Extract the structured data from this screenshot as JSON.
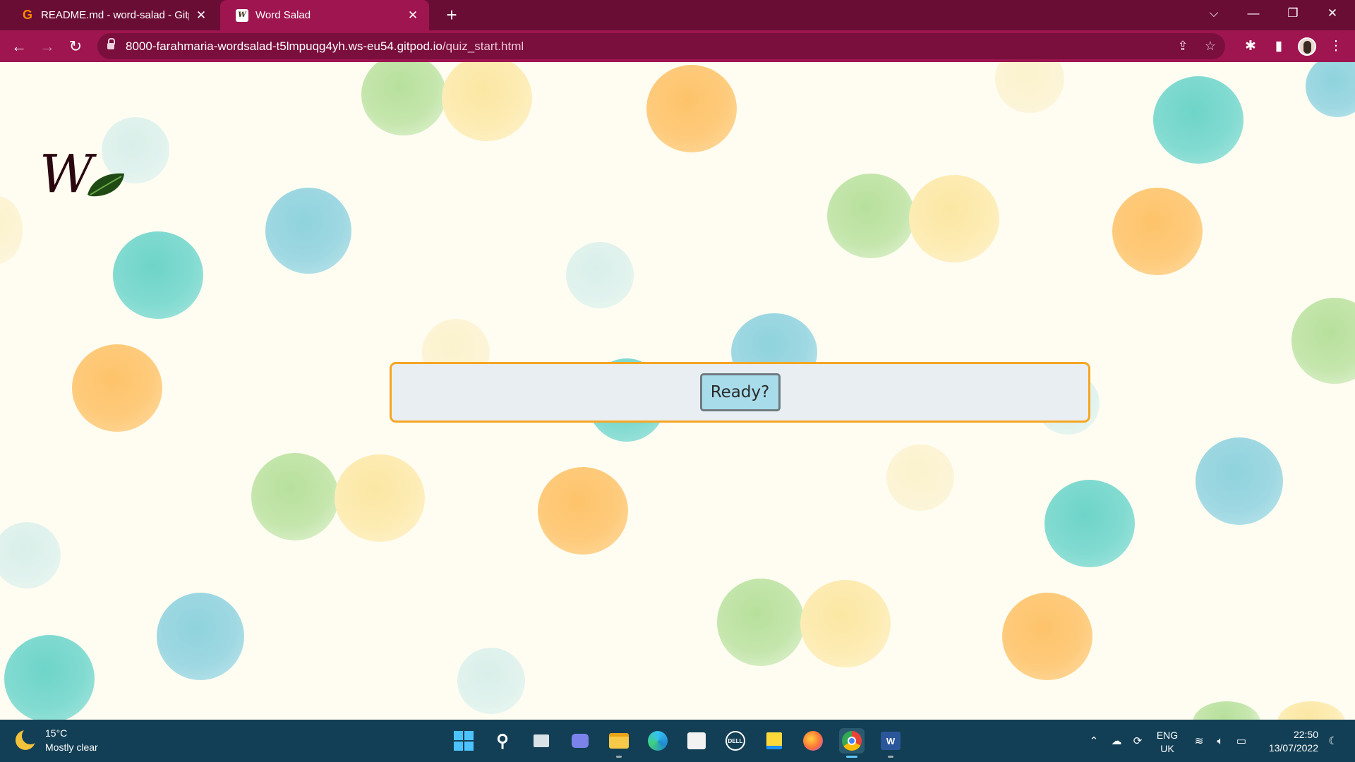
{
  "browser": {
    "tabs": [
      {
        "title": "README.md - word-salad - Gitpod",
        "icon": "gitpod-icon",
        "active": false
      },
      {
        "title": "Word Salad",
        "icon": "word-salad-favicon",
        "active": true
      }
    ],
    "url_host": "8000-farahmaria-wordsalad-t5lmpuqg4yh.ws-eu54.gitpod.io",
    "url_path": "/quiz_start.html",
    "accent_color": "#9f154f",
    "tabbar_color": "#6a0d35"
  },
  "page": {
    "logo_letter": "W",
    "quiz": {
      "ready_label": "Ready?"
    },
    "panel_border_color": "#f5a623",
    "background_color": "#fffdf1"
  },
  "taskbar": {
    "weather": {
      "temp": "15°C",
      "condition": "Mostly clear"
    },
    "language": {
      "line1": "ENG",
      "line2": "UK"
    },
    "clock": {
      "time": "22:50",
      "date": "13/07/2022"
    },
    "apps": [
      "start",
      "search",
      "task-view",
      "teams",
      "file-explorer",
      "edge",
      "store",
      "dell",
      "sticky-notes",
      "firefox",
      "chrome",
      "word"
    ]
  }
}
